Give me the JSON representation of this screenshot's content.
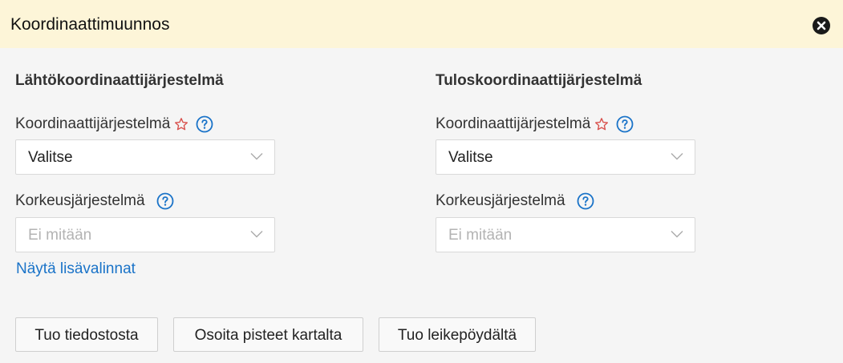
{
  "dialog": {
    "title": "Koordinaattimuunnos",
    "close_icon": "close-icon"
  },
  "source": {
    "title": "Lähtökoordinaattijärjestelmä",
    "crs_label": "Koordinaattijärjestelmä",
    "crs_value": "Valitse",
    "height_label": "Korkeusjärjestelmä",
    "height_placeholder": "Ei mitään",
    "show_more": "Näytä lisävalinnat"
  },
  "target": {
    "title": "Tuloskoordinaattijärjestelmä",
    "crs_label": "Koordinaattijärjestelmä",
    "crs_value": "Valitse",
    "height_label": "Korkeusjärjestelmä",
    "height_placeholder": "Ei mitään"
  },
  "buttons": {
    "from_file": "Tuo tiedostosta",
    "from_map": "Osoita pisteet kartalta",
    "from_clipboard": "Tuo leikepöydältä"
  },
  "colors": {
    "header_bg": "#fdf5d8",
    "accent": "#1a73c8",
    "required_star": "#d9534f"
  }
}
